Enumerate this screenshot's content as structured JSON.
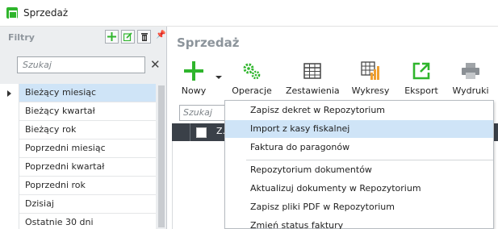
{
  "window": {
    "title": "Sprzedaż",
    "icon": "shop-icon",
    "icon_color": "#2fb52c"
  },
  "filters": {
    "header": "Filtry",
    "toolbar_icons": [
      "add-icon",
      "edit-icon",
      "delete-icon",
      "pin-icon"
    ],
    "search_placeholder": "Szukaj",
    "clear_symbol": "✕",
    "items": [
      {
        "label": "Bieżący miesiąc",
        "selected": true
      },
      {
        "label": "Bieżący kwartał",
        "selected": false
      },
      {
        "label": "Bieżący rok",
        "selected": false
      },
      {
        "label": "Poprzedni miesiąc",
        "selected": false
      },
      {
        "label": "Poprzedni kwartał",
        "selected": false
      },
      {
        "label": "Poprzedni rok",
        "selected": false
      },
      {
        "label": "Dzisiaj",
        "selected": false
      },
      {
        "label": "Ostatnie 30 dni",
        "selected": false
      }
    ]
  },
  "main": {
    "title": "Sprzedaż",
    "ribbon": [
      {
        "label": "Nowy",
        "icon": "plus-icon"
      },
      {
        "label": "Operacje",
        "icon": "gears-icon"
      },
      {
        "label": "Zestawienia",
        "icon": "table-icon"
      },
      {
        "label": "Wykresy",
        "icon": "chart-icon"
      },
      {
        "label": "Eksport",
        "icon": "export-icon"
      },
      {
        "label": "Wydruki",
        "icon": "printer-icon"
      }
    ],
    "grid": {
      "search_placeholder": "Szukaj",
      "first_column": "Z..."
    }
  },
  "context_menu": {
    "items": [
      {
        "label": "Zapisz dekret w Repozytorium",
        "highlighted": false
      },
      {
        "label": "Import z kasy fiskalnej",
        "highlighted": true
      },
      {
        "label": "Faktura do paragonów",
        "highlighted": false
      },
      {
        "label": "Repozytorium dokumentów",
        "highlighted": false
      },
      {
        "label": "Aktualizuj dokumenty w Repozytorium",
        "highlighted": false
      },
      {
        "label": "Zapisz pliki PDF w Repozytorium",
        "highlighted": false
      },
      {
        "label": "Zmień status faktury",
        "highlighted": false
      }
    ]
  },
  "colors": {
    "accent_green": "#2fb52c",
    "selection": "#cfe4f7",
    "grid_header": "#3a4048",
    "chart_orange": "#f0a030"
  }
}
